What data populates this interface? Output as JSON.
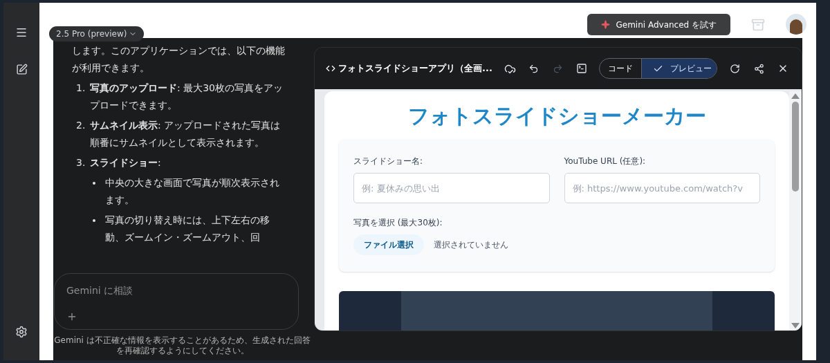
{
  "model_selector": {
    "label": "2.5 Pro (preview)"
  },
  "upgrade_button": {
    "label": "Gemini Advanced を試す"
  },
  "chat": {
    "intro": "します。このアプリケーションでは、以下の機能が利用できます。",
    "items": [
      {
        "number": "1.",
        "text": "**写真のアップロード**: 最大30枚の写真をアップロードできます。"
      },
      {
        "number": "2.",
        "text": "**サムネイル表示**: アップロードされた写真は順番にサムネイルとして表示されます。"
      },
      {
        "number": "3.",
        "text": "**スライドショー**:",
        "children": [
          {
            "text": "中央の大きな画面で写真が順次表示されます。"
          },
          {
            "text": "写真の切り替え時には、上下左右の移動、ズームイン・ズームアウト、回"
          }
        ]
      }
    ]
  },
  "prompt": {
    "placeholder": "Gemini に相談"
  },
  "disclaimer": "Gemini は不正確な情報を表示することがあるため、生成された回答を再確認するようにしてください。",
  "canvas": {
    "title": "フォトスライドショーアプリ（全画...",
    "redo_disabled": true,
    "view_toggle": [
      {
        "label": "コード",
        "selected": false
      },
      {
        "label": "プレビュー",
        "selected": true
      }
    ],
    "preview": {
      "heading": "フォトスライドショーメーカー",
      "name_field": {
        "label": "スライドショー名:",
        "placeholder": "例: 夏休みの思い出"
      },
      "url_field": {
        "label": "YouTube URL (任意):",
        "placeholder": "例: https://www.youtube.com/watch?v"
      },
      "photos": {
        "label": "写真を選択 (最大30枚):",
        "button": "ファイル選択",
        "status": "選択されていません"
      }
    }
  }
}
